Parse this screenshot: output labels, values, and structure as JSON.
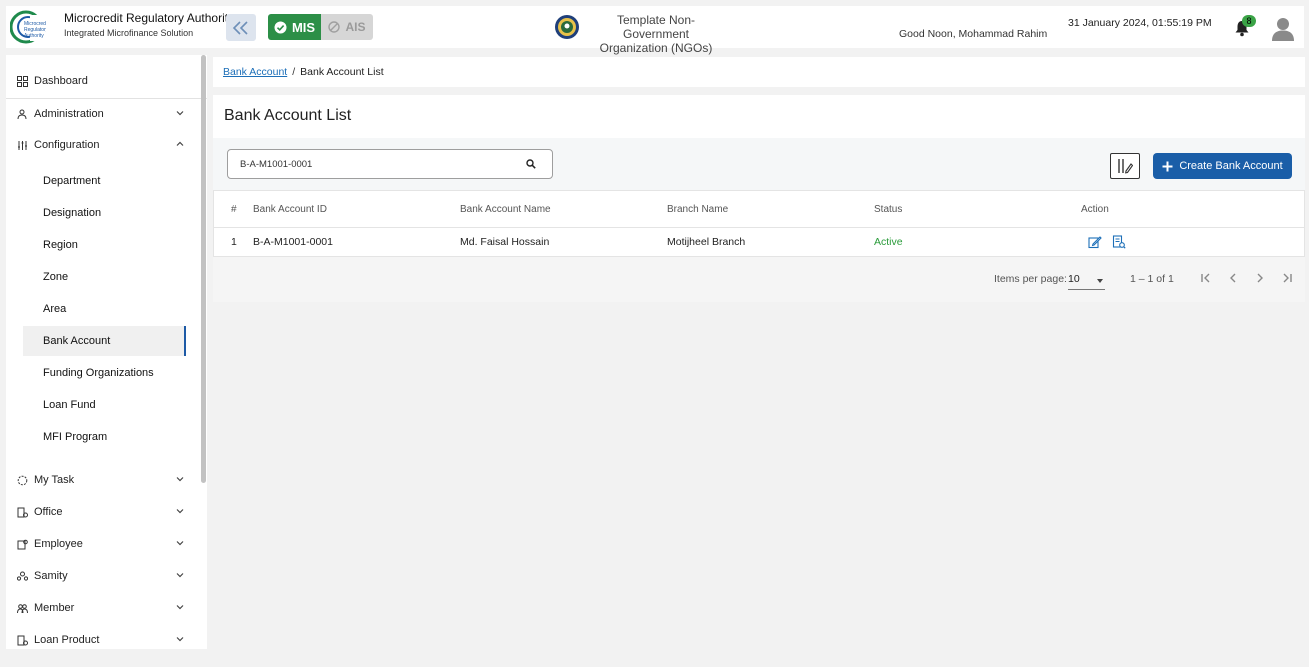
{
  "header": {
    "org_name": "Microcredit Regulatory Authority",
    "org_subtitle": "Integrated Microfinance Solution",
    "mis_label": "MIS",
    "ais_label": "AIS",
    "ngo_line1": "Template Non-Government",
    "ngo_line2": "Organization (NGOs)",
    "greeting": "Good Noon, Mohammad Rahim",
    "datetime": "31 January 2024, 01:55:19 PM",
    "notification_count": "8"
  },
  "sidebar": {
    "dashboard": "Dashboard",
    "administration": "Administration",
    "configuration": "Configuration",
    "config_items": [
      "Department",
      "Designation",
      "Region",
      "Zone",
      "Area",
      "Bank Account",
      "Funding Organizations",
      "Loan Fund",
      "MFI Program"
    ],
    "my_task": "My Task",
    "office": "Office",
    "employee": "Employee",
    "samity": "Samity",
    "member": "Member",
    "loan_product": "Loan Product"
  },
  "breadcrumb": {
    "parent": "Bank Account",
    "current": "Bank Account List"
  },
  "page_title": "Bank Account List",
  "search": {
    "value": "B-A-M1001-0001"
  },
  "create_button": "Create Bank Account",
  "table": {
    "headers": [
      "#",
      "Bank Account ID",
      "Bank Account Name",
      "Branch Name",
      "Status",
      "Action"
    ],
    "rows": [
      {
        "num": "1",
        "id": "B-A-M1001-0001",
        "name": "Md. Faisal Hossain",
        "branch": "Motijheel Branch",
        "status": "Active"
      }
    ]
  },
  "pagination": {
    "items_label": "Items per page:",
    "page_size": "10",
    "range": "1 – 1 of 1"
  },
  "colors": {
    "primary": "#1a5ea8",
    "mis_green": "#2c8f47",
    "active_green": "#2a9b3a"
  }
}
